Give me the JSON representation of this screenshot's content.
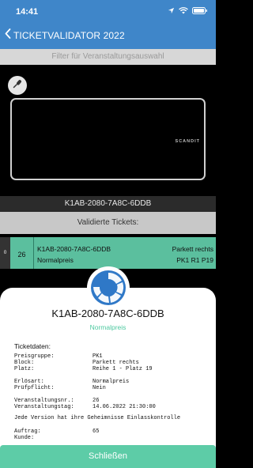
{
  "status_bar": {
    "time": "14:41",
    "icons": [
      "location-arrow-icon",
      "wifi-icon",
      "battery-icon"
    ]
  },
  "nav": {
    "back_icon": "chevron-left-icon",
    "title": "TICKETVALIDATOR 2022"
  },
  "filter": {
    "placeholder": "Filter für Veranstaltungsauswahl"
  },
  "scanner": {
    "mic_icon": "microphone-icon",
    "brand": "SCANDIT"
  },
  "scanned_code": "K1AB-2080-7A8C-6DDB",
  "validated_header": "Validierte Tickets:",
  "validated_tickets": [
    {
      "index": "0",
      "event_no": "26",
      "code": "K1AB-2080-7A8C-6DDB",
      "type": "Normalpreis",
      "block": "Parkett rechts",
      "seat": "PK1 R1 P19"
    }
  ],
  "detail": {
    "logo": "eventim-style-logo-icon",
    "code": "K1AB-2080-7A8C-6DDB",
    "price_type": "Normalpreis",
    "section_title": "Ticketdaten:",
    "fields": [
      {
        "label": "Preisgruppe:",
        "value": "PK1"
      },
      {
        "label": "Block:",
        "value": "Parkett rechts"
      },
      {
        "label": "Platz:",
        "value": "Reihe 1 - Platz 19"
      },
      {
        "label": "Erlösart:",
        "value": "Normalpreis"
      },
      {
        "label": "Prüfpflicht:",
        "value": "Nein"
      },
      {
        "label": "Veranstaltungsnr.:",
        "value": "26"
      },
      {
        "label": "Veranstaltungstag:",
        "value": "14.06.2022 21:30:00"
      },
      {
        "label": "Auftrag:",
        "value": "65"
      },
      {
        "label": "Kunde:",
        "value": ""
      }
    ],
    "note": "Jede Version hat ihre Geheimnisse Einlasskontrolle",
    "close_label": "Schließen"
  },
  "colors": {
    "accent": "#3f86c9",
    "validated": "#5bbf9e",
    "button": "#5dcca7",
    "price_type": "#4ec9a0"
  }
}
